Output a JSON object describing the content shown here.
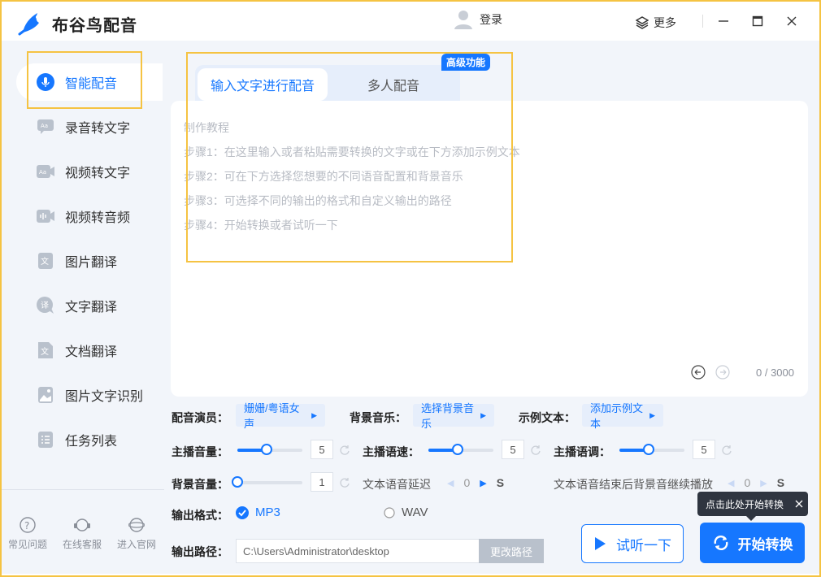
{
  "app": {
    "title": "布谷鸟配音",
    "login": "登录",
    "more": "更多"
  },
  "sidebar": {
    "items": [
      {
        "label": "智能配音",
        "icon": "mic-icon"
      },
      {
        "label": "录音转文字",
        "icon": "audio-to-text-icon"
      },
      {
        "label": "视频转文字",
        "icon": "video-to-text-icon"
      },
      {
        "label": "视频转音频",
        "icon": "video-to-audio-icon"
      },
      {
        "label": "图片翻译",
        "icon": "image-translate-icon"
      },
      {
        "label": "文字翻译",
        "icon": "text-translate-icon"
      },
      {
        "label": "文档翻译",
        "icon": "document-translate-icon"
      },
      {
        "label": "图片文字识别",
        "icon": "ocr-icon"
      },
      {
        "label": "任务列表",
        "icon": "task-list-icon"
      }
    ],
    "bottom": [
      {
        "label": "常见问题",
        "icon": "help-icon"
      },
      {
        "label": "在线客服",
        "icon": "headset-icon"
      },
      {
        "label": "进入官网",
        "icon": "globe-icon"
      }
    ]
  },
  "tabs": {
    "active": "输入文字进行配音",
    "inactive": "多人配音",
    "badge": "高级功能"
  },
  "editor": {
    "tutorial_title": "制作教程",
    "steps": [
      "步骤1：在这里输入或者粘贴需要转换的文字或在下方添加示例文本",
      "步骤2：可在下方选择您想要的不同语音配置和背景音乐",
      "步骤3：可选择不同的输出的格式和自定义输出的路径",
      "步骤4：开始转换或者试听一下"
    ],
    "counter": "0 / 3000"
  },
  "settings": {
    "voice_label": "配音演员：",
    "voice_value": "姗姗/粤语女声",
    "bgm_label": "背景音乐：",
    "bgm_value": "选择背景音乐",
    "sample_label": "示例文本：",
    "sample_value": "添加示例文本",
    "volume_label": "主播音量：",
    "volume_value": "5",
    "volume_level": 0.45,
    "speed_label": "主播语速：",
    "speed_value": "5",
    "speed_level": 0.45,
    "pitch_label": "主播语调：",
    "pitch_value": "5",
    "pitch_level": 0.45,
    "bg_volume_label": "背景音量：",
    "bg_volume_value": "1",
    "bg_volume_level": 0.0,
    "delay_label": "文本语音延迟",
    "delay_value": "0",
    "delay_unit": "S",
    "continue_label": "文本语音结束后背景音继续播放",
    "continue_value": "0",
    "continue_unit": "S",
    "format_label": "输出格式：",
    "format_mp3": "MP3",
    "format_wav": "WAV",
    "path_label": "输出路径：",
    "path_value": "C:\\Users\\Administrator\\desktop",
    "path_button": "更改路径"
  },
  "actions": {
    "listen": "试听一下",
    "start": "开始转换",
    "tooltip": "点击此处开始转换"
  },
  "colors": {
    "accent": "#1677ff",
    "highlight": "#f5c342",
    "sidebar_bg": "#f2f5fa"
  }
}
